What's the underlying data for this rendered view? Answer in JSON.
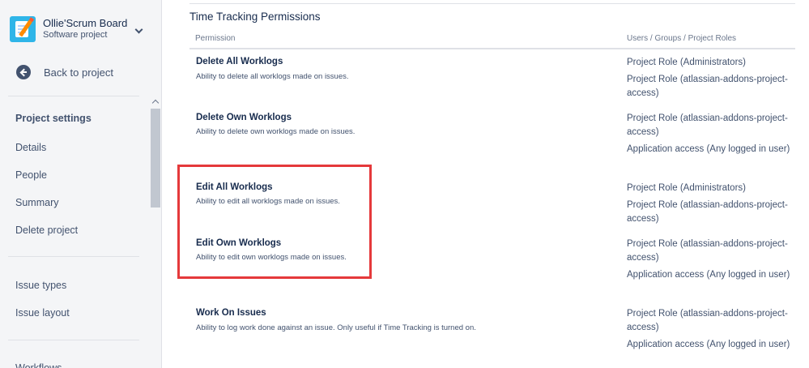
{
  "project": {
    "name": "Ollie'Scrum Board",
    "type": "Software project"
  },
  "sidebar": {
    "back_label": "Back to project",
    "heading": "Project settings",
    "items": [
      "Details",
      "People",
      "Summary",
      "Delete project"
    ],
    "items2": [
      "Issue types",
      "Issue layout"
    ],
    "items3": [
      "Workflows"
    ]
  },
  "section": {
    "title": "Time Tracking Permissions",
    "col_permission": "Permission",
    "col_users": "Users / Groups / Project Roles"
  },
  "permissions": [
    {
      "name": "Delete All Worklogs",
      "desc": "Ability to delete all worklogs made on issues.",
      "grants": [
        "Project Role (Administrators)",
        "Project Role (atlassian-addons-project-access)"
      ]
    },
    {
      "name": "Delete Own Worklogs",
      "desc": "Ability to delete own worklogs made on issues.",
      "grants": [
        "Project Role (atlassian-addons-project-access)",
        "Application access (Any logged in user)"
      ]
    },
    {
      "name": "Edit All Worklogs",
      "desc": "Ability to edit all worklogs made on issues.",
      "grants": [
        "Project Role (Administrators)",
        "Project Role (atlassian-addons-project-access)"
      ]
    },
    {
      "name": "Edit Own Worklogs",
      "desc": "Ability to edit own worklogs made on issues.",
      "grants": [
        "Project Role (atlassian-addons-project-access)",
        "Application access (Any logged in user)"
      ]
    },
    {
      "name": "Work On Issues",
      "desc": "Ability to log work done against an issue. Only useful if Time Tracking is turned on.",
      "grants": [
        "Project Role (atlassian-addons-project-access)",
        "Application access (Any logged in user)"
      ]
    }
  ],
  "colors": {
    "highlight": "#e5393b",
    "avatar": "#2fb5e8"
  }
}
